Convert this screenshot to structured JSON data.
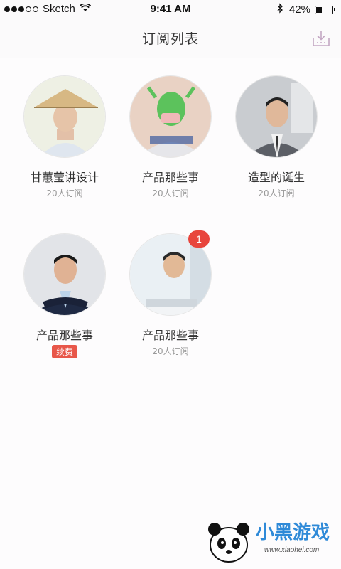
{
  "status_bar": {
    "carrier": "Sketch",
    "time": "9:41 AM",
    "battery_percent_text": "42%",
    "battery_level": 0.42,
    "signal_dots_filled": 3,
    "signal_dots_total": 5,
    "icons": [
      "wifi-icon",
      "bluetooth-icon",
      "battery-icon"
    ]
  },
  "nav": {
    "title": "订阅列表",
    "download_icon": "download-icon"
  },
  "subscriptions": [
    {
      "title": "甘蕙莹讲设计",
      "subtitle": "20人订阅"
    },
    {
      "title": "产品那些事",
      "subtitle": "20人订阅"
    },
    {
      "title": "造型的诞生",
      "subtitle": "20人订阅"
    },
    {
      "title": "产品那些事",
      "renew_label": "续费"
    },
    {
      "title": "产品那些事",
      "subtitle": "20人订阅",
      "badge": "1"
    }
  ],
  "watermark": {
    "text": "小黑游戏",
    "url": "www.xiaohei.com"
  },
  "colors": {
    "accent_red": "#e8453c",
    "text_primary": "#333333",
    "text_secondary": "#999999"
  }
}
